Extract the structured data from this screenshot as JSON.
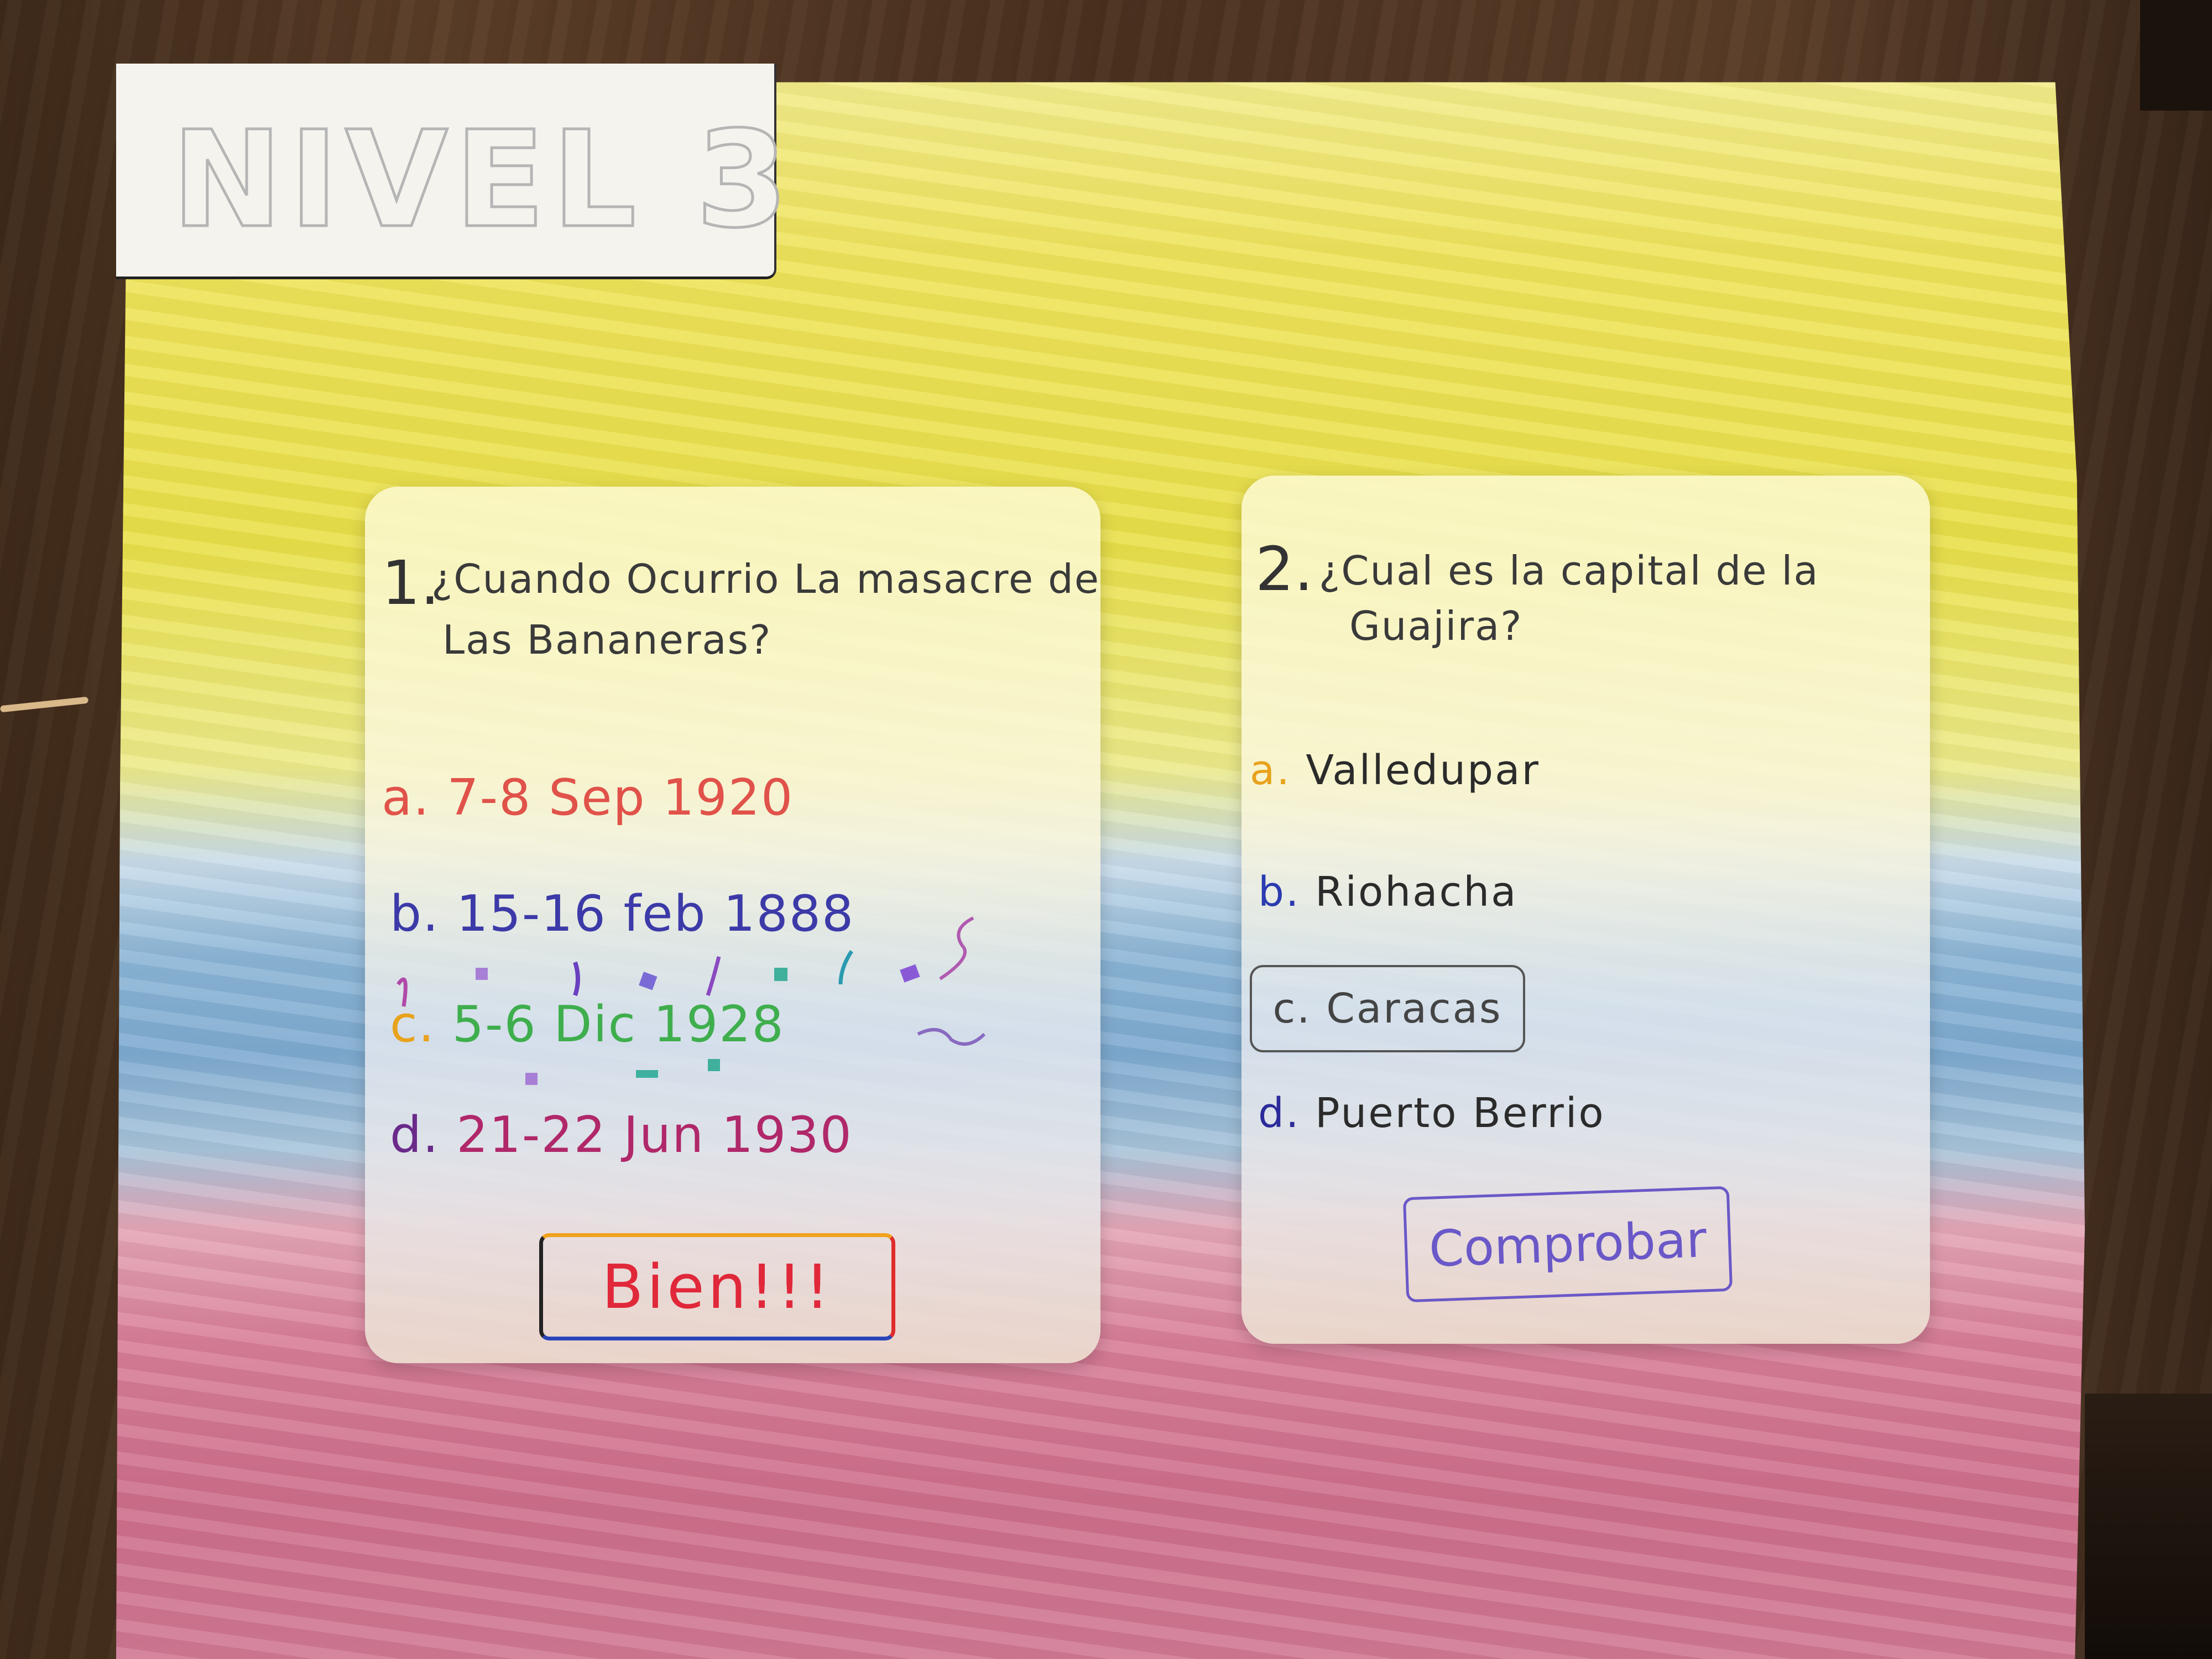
{
  "title": "NIVEL 3",
  "question_1": {
    "number": "1.",
    "text_line1": "¿Cuando Ocurrio La masacre de",
    "text_line2": "Las Bananeras?",
    "options": [
      {
        "letter": "a.",
        "text": "7-8 Sep  1920",
        "color": "#e0524a"
      },
      {
        "letter": "b.",
        "text": "15-16 feb  1888",
        "color": "#3c3aa8"
      },
      {
        "letter": "c.",
        "text": "5-6 Dic  1928",
        "color": "#3fae4d"
      },
      {
        "letter": "d.",
        "text": "21-22 Jun  1930",
        "color": "#b0286a"
      }
    ],
    "button_label": "Bien!!!"
  },
  "question_2": {
    "number": "2.",
    "text_line1": "¿Cual es la capital de la",
    "text_line2": "Guajira?",
    "options": [
      {
        "letter": "a.",
        "text": "Valledupar",
        "color": "#e8a21c"
      },
      {
        "letter": "b.",
        "text": "Riohacha",
        "color": "#2b3bb0"
      },
      {
        "letter": "c.",
        "text": "Caracas",
        "color": "#444444"
      },
      {
        "letter": "d.",
        "text": "Puerto Berrio",
        "color": "#2b2b9a"
      }
    ],
    "button_label": "Comprobar"
  },
  "colors": {
    "flag_yellow": "#e9e049",
    "flag_blue": "#7eaad0",
    "flag_red": "#cd6e8b",
    "bien_text": "#e0283a",
    "comprobar": "#6a58c8"
  }
}
